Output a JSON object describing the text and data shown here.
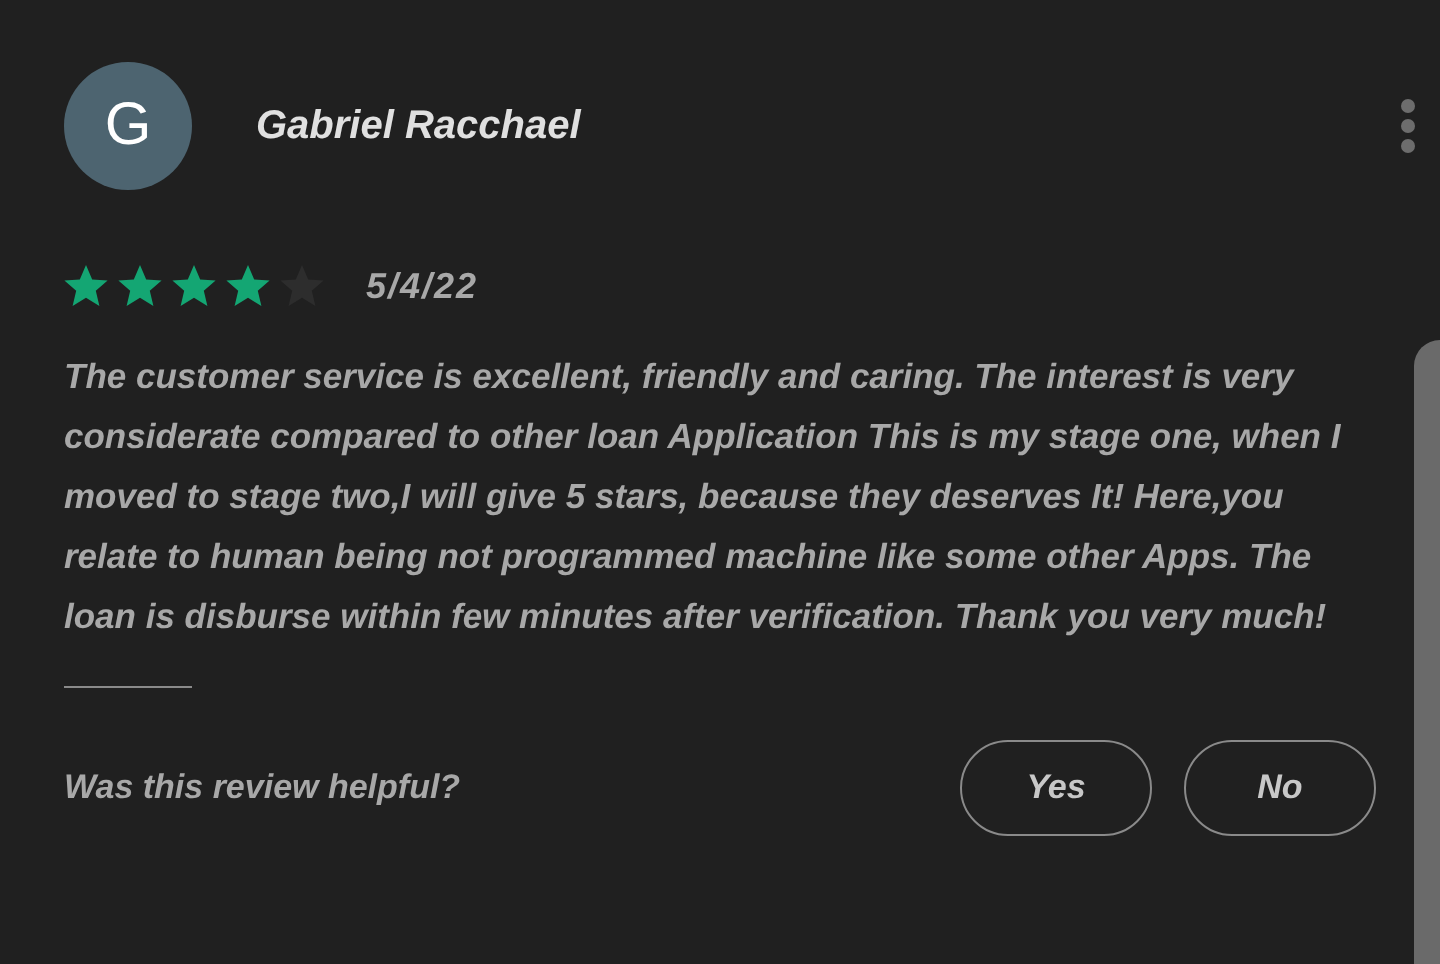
{
  "review": {
    "avatar_letter": "G",
    "author": "Gabriel Racchael",
    "stars": 4,
    "date": "5/4/22",
    "text": "The customer service is excellent, friendly and caring. The interest is very considerate compared to other loan Application This is my stage one, when I moved to stage two,I will give 5 stars, because they deserves It! Here,you relate to human being not programmed machine like some other Apps. The loan is disburse within few minutes after verification. Thank you very much!"
  },
  "helpful": {
    "question": "Was this review helpful?",
    "buttons": [
      "Yes",
      "No"
    ]
  }
}
